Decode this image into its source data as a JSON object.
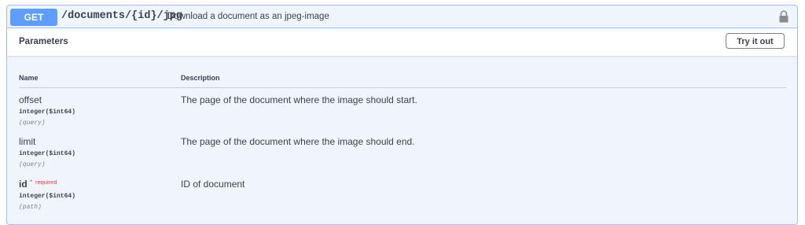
{
  "operation": {
    "method": "GET",
    "path": "/documents/{id}/jpg",
    "summary": "Download a document as an jpeg-image",
    "lock_icon": "lock-icon"
  },
  "parameters_section": {
    "title": "Parameters",
    "try_button": "Try it out",
    "columns": {
      "name": "Name",
      "description": "Description"
    },
    "params": [
      {
        "name": "offset",
        "type": "integer($int64)",
        "in": "(query)",
        "description": "The page of the document where the image should start."
      },
      {
        "name": "limit",
        "type": "integer($int64)",
        "in": "(query)",
        "description": "The page of the document where the image should end."
      },
      {
        "name": "id",
        "required_mark": "*",
        "required_label": "required",
        "type": "integer($int64)",
        "in": "(path)",
        "description": "ID of document"
      }
    ]
  },
  "colors": {
    "method_bg": "#5f9dff",
    "block_bg": "#eff4fd",
    "block_border": "#a3c0f4",
    "required": "#f93e3e"
  }
}
